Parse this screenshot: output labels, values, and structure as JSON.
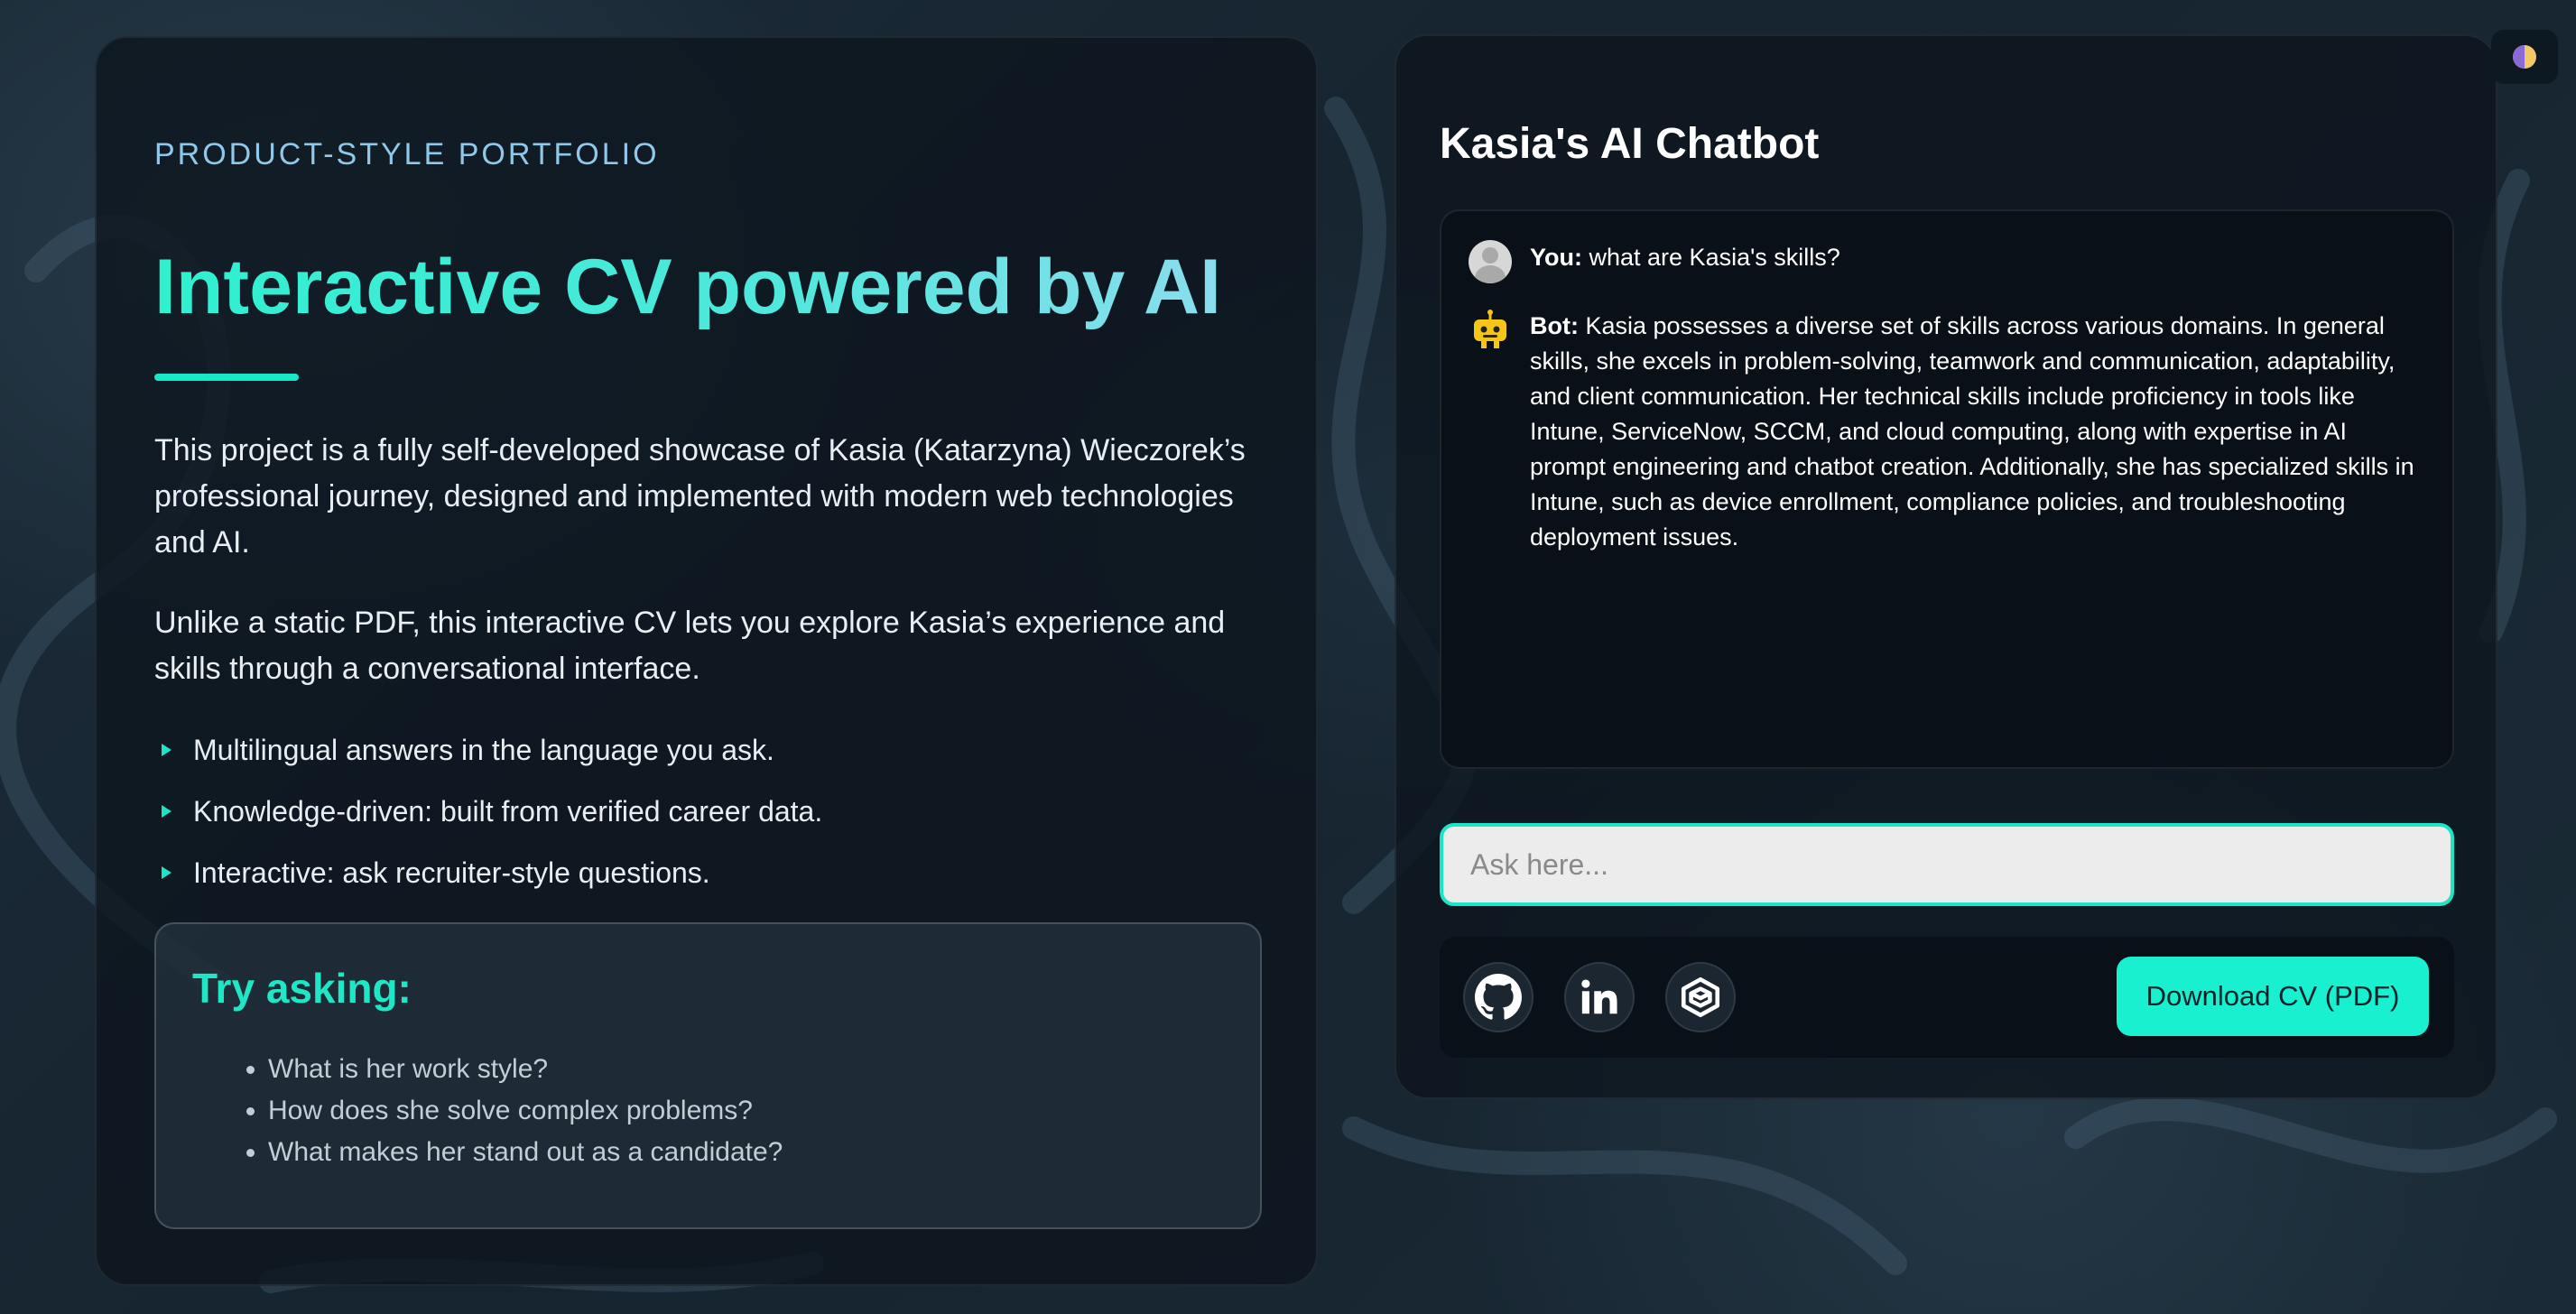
{
  "left": {
    "eyebrow": "PRODUCT-STYLE PORTFOLIO",
    "title": "Interactive CV powered by AI",
    "paragraph1": "This project is a fully self-developed showcase of Kasia (Katarzyna) Wieczorek’s professional journey, designed and implemented with modern web technologies and AI.",
    "paragraph2": "Unlike a static PDF, this interactive CV lets you explore Kasia’s experience and skills through a conversational interface.",
    "features": [
      "Multilingual answers in the language you ask.",
      "Knowledge-driven: built from verified career data.",
      "Interactive: ask recruiter-style questions."
    ],
    "try": {
      "title": "Try asking:",
      "questions": [
        "What is her work style?",
        "How does she solve complex problems?",
        "What makes her stand out as a candidate?"
      ]
    }
  },
  "chat": {
    "title": "Kasia's AI Chatbot",
    "messages": [
      {
        "speaker": "You:",
        "text": "what are Kasia's skills?"
      },
      {
        "speaker": "Bot:",
        "text": "Kasia possesses a diverse set of skills across various domains. In general skills, she excels in problem-solving, teamwork and communication, adaptability, and client communication. Her technical skills include proficiency in tools like Intune, ServiceNow, SCCM, and cloud computing, along with expertise in AI prompt engineering and chatbot creation. Additionally, she has specialized skills in Intune, such as device enrollment, compliance policies, and troubleshooting deployment issues."
      }
    ],
    "input_placeholder": "Ask here...",
    "download_label": "Download CV (PDF)",
    "social_icons": [
      "github-icon",
      "linkedin-icon",
      "codewars-icon"
    ]
  },
  "colors": {
    "accent": "#19e6c6",
    "background": "#16242f",
    "card": "#0e161e"
  }
}
